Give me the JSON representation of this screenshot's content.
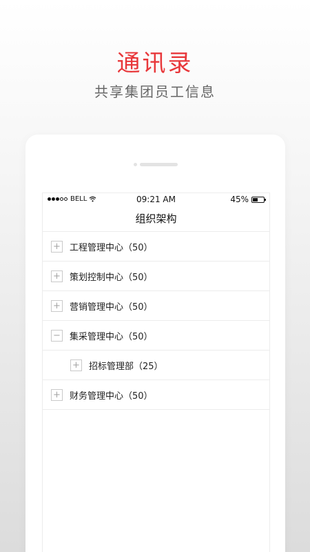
{
  "hero": {
    "title": "通讯录",
    "subtitle": "共享集团员工信息"
  },
  "status_bar": {
    "carrier": "BELL",
    "time": "09:21 AM",
    "battery_text": "45%",
    "battery_level": 0.45
  },
  "screen": {
    "title": "组织架构"
  },
  "tree": [
    {
      "label": "工程管理中心（50）",
      "toggle": "+",
      "expanded": false
    },
    {
      "label": "策划控制中心（50）",
      "toggle": "+",
      "expanded": false
    },
    {
      "label": "营销管理中心（50）",
      "toggle": "+",
      "expanded": false
    },
    {
      "label": "集采管理中心（50）",
      "toggle": "−",
      "expanded": true
    },
    {
      "label": "招标管理部（25）",
      "toggle": "+",
      "expanded": false,
      "child": true
    },
    {
      "label": "财务管理中心（50）",
      "toggle": "+",
      "expanded": false
    }
  ],
  "colors": {
    "accent": "#e8373a",
    "subtitle": "#666666",
    "divider": "#ececec"
  }
}
